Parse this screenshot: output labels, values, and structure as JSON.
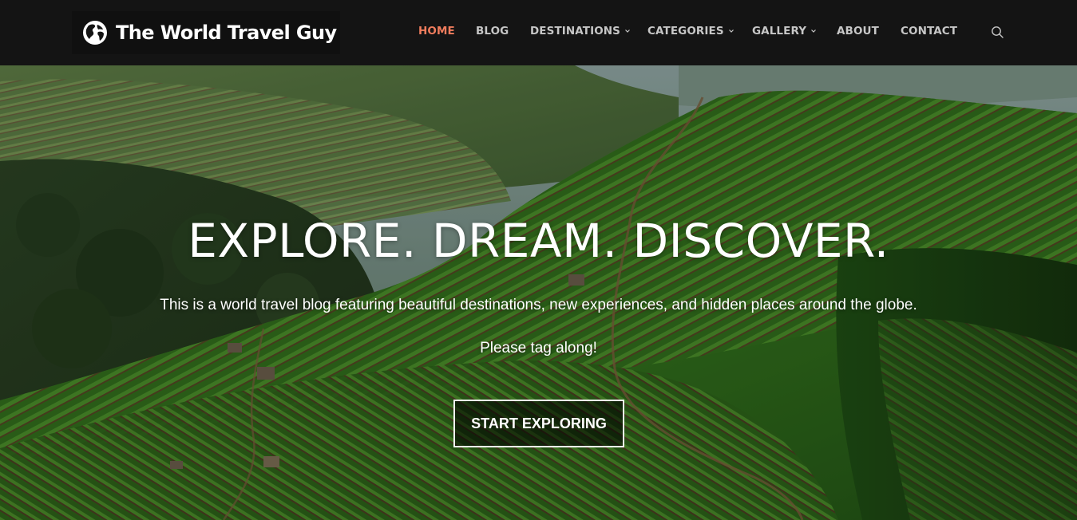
{
  "site": {
    "name": "The World Travel Guy",
    "logo_icon": "globe-icon"
  },
  "nav": {
    "items": [
      {
        "label": "HOME",
        "active": true,
        "dropdown": false
      },
      {
        "label": "BLOG",
        "active": false,
        "dropdown": false
      },
      {
        "label": "DESTINATIONS",
        "active": false,
        "dropdown": true
      },
      {
        "label": "CATEGORIES",
        "active": false,
        "dropdown": true
      },
      {
        "label": "GALLERY",
        "active": false,
        "dropdown": true
      },
      {
        "label": "ABOUT",
        "active": false,
        "dropdown": false
      },
      {
        "label": "CONTACT",
        "active": false,
        "dropdown": false
      }
    ],
    "search_icon": "search-icon"
  },
  "hero": {
    "title": "EXPLORE. DREAM. DISCOVER.",
    "subtitle": "This is a world travel blog featuring beautiful destinations, new experiences, and hidden places around the globe.",
    "tagline": "Please tag along!",
    "cta_label": "START EXPLORING",
    "background": "terraced-hills-photo"
  },
  "colors": {
    "nav_bg": "#141414",
    "nav_text": "#c7c7c7",
    "accent": "#f07c5d",
    "hero_text": "#ffffff"
  }
}
